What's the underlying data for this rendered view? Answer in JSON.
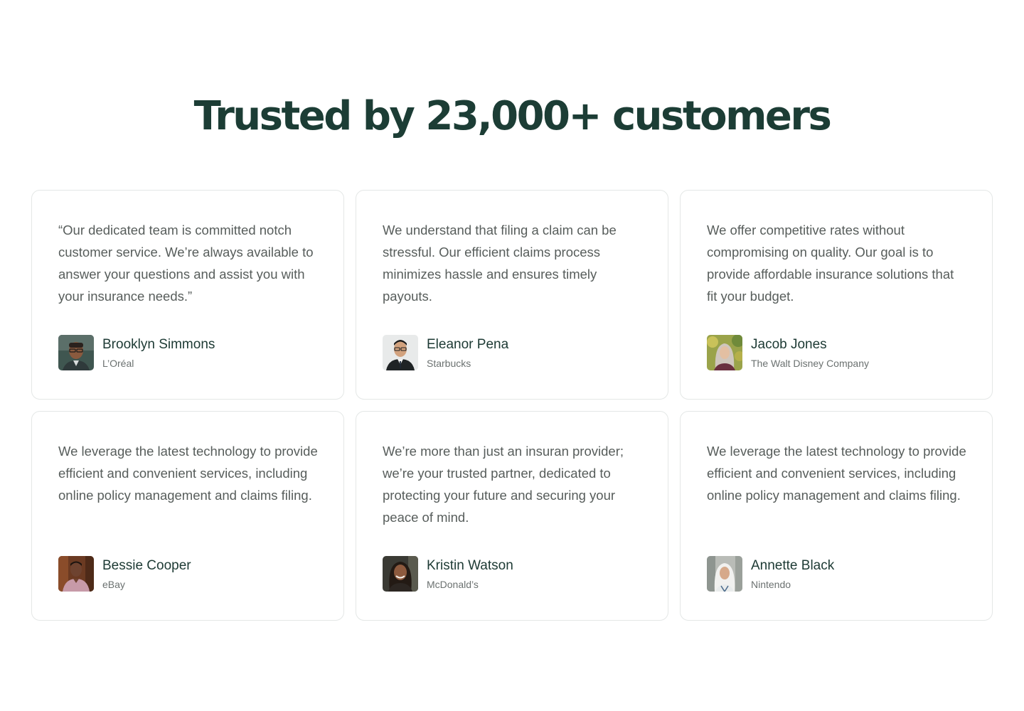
{
  "section": {
    "title": "Trusted by 23,000+ customers"
  },
  "testimonials": [
    {
      "quote": "“Our dedicated team is committed notch customer service. We’re always available to answer your questions and assist you with your insurance needs.”",
      "name": "Brooklyn Simmons",
      "company": "L’Oréal",
      "avatar_icon": "avatar-photo-man-glasses"
    },
    {
      "quote": "We understand that filing a claim can be stressful. Our efficient claims process minimizes hassle and ensures timely payouts.",
      "name": "Eleanor Pena",
      "company": "Starbucks",
      "avatar_icon": "avatar-photo-man-suit"
    },
    {
      "quote": "We offer competitive rates without compromising on quality. Our goal is to provide affordable insurance solutions that fit your budget.",
      "name": "Jacob Jones",
      "company": "The Walt Disney Company",
      "avatar_icon": "avatar-photo-woman-hijab"
    },
    {
      "quote": "We leverage the latest technology to provide efficient and convenient services, including online policy management and claims filing.",
      "name": "Bessie Cooper",
      "company": "eBay",
      "avatar_icon": "avatar-photo-man-pink-shirt"
    },
    {
      "quote": "We’re more than just an insuran provider; we’re your trusted partner, dedicated to protecting your future and securing your peace of mind.",
      "name": "Kristin Watson",
      "company": "McDonald’s",
      "avatar_icon": "avatar-photo-woman-smiling"
    },
    {
      "quote": "We leverage the latest technology to provide efficient and convenient services, including online policy management and claims filing.",
      "name": "Annette Black",
      "company": "Nintendo",
      "avatar_icon": "avatar-photo-woman-white-hijab"
    }
  ],
  "colors": {
    "heading": "#1c3d35",
    "name": "#1d3a34",
    "quote": "#575d5b",
    "company": "#6b7170",
    "card_border": "#e4e7e6"
  }
}
